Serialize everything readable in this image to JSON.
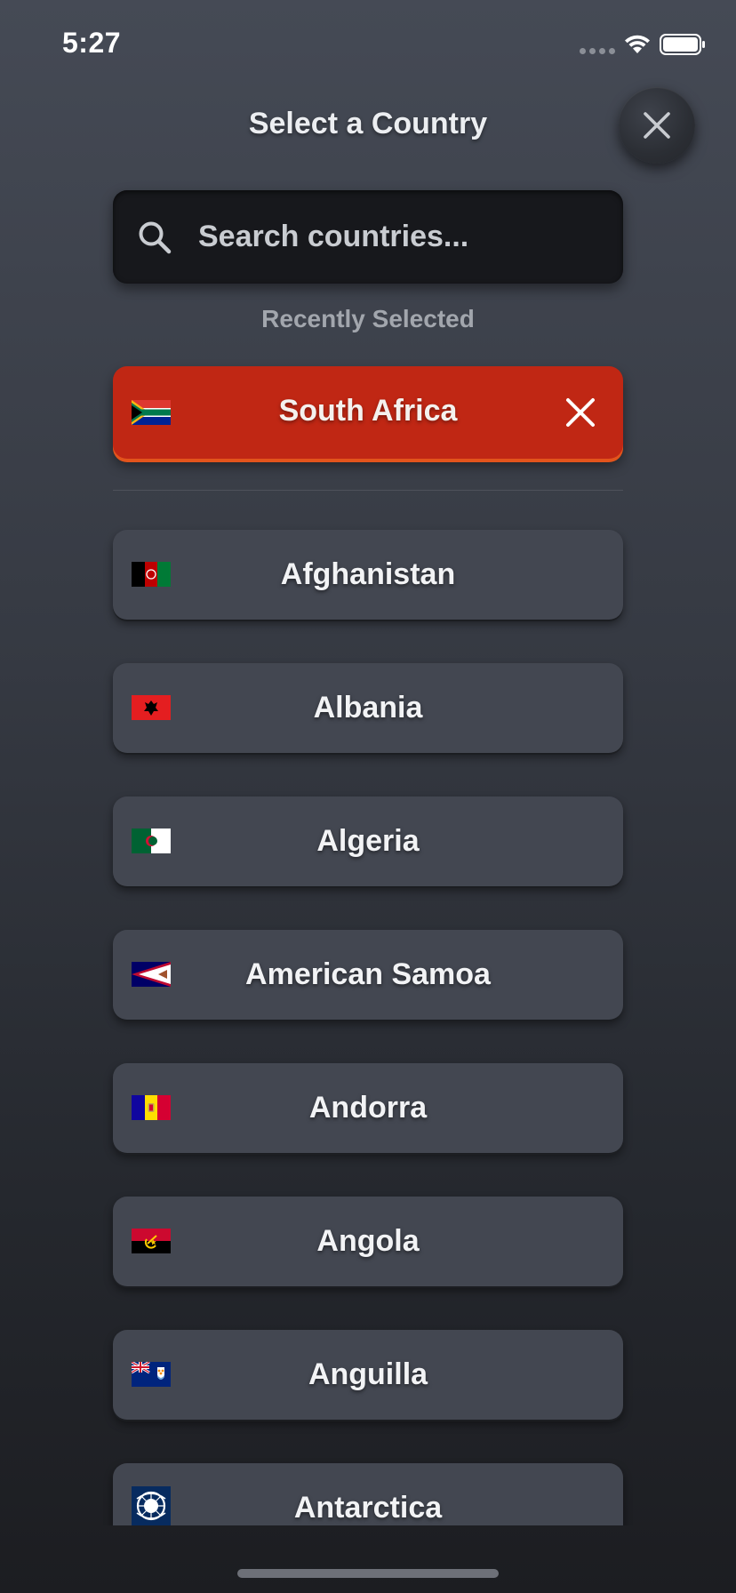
{
  "status_bar": {
    "time": "5:27"
  },
  "header": {
    "title": "Select a Country"
  },
  "search": {
    "placeholder": "Search countries..."
  },
  "recent": {
    "label": "Recently Selected",
    "selected": {
      "name": "South Africa",
      "flag": "za-flag-icon",
      "accent": "#c02714"
    }
  },
  "countries": [
    {
      "name": "Afghanistan",
      "flag": "af-flag-icon"
    },
    {
      "name": "Albania",
      "flag": "al-flag-icon"
    },
    {
      "name": "Algeria",
      "flag": "dz-flag-icon"
    },
    {
      "name": "American Samoa",
      "flag": "as-flag-icon"
    },
    {
      "name": "Andorra",
      "flag": "ad-flag-icon"
    },
    {
      "name": "Angola",
      "flag": "ao-flag-icon"
    },
    {
      "name": "Anguilla",
      "flag": "ai-flag-icon"
    },
    {
      "name": "Antarctica",
      "flag": "aq-flag-icon"
    }
  ]
}
